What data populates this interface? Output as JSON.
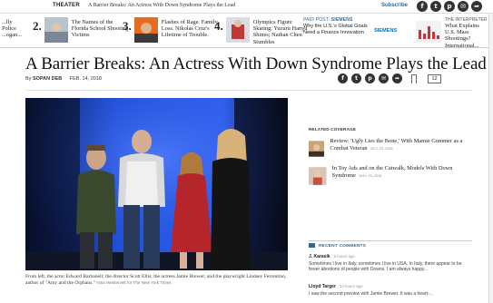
{
  "topbar": {
    "section": "THEATER",
    "headline": "A Barrier Breaks: An Actress With Down Syndrome Plays the Lead",
    "subscribe": "Subscribe"
  },
  "trending": [
    {
      "num": "",
      "text": "...lly\nPolice\n...ogan..."
    },
    {
      "num": "2.",
      "text": "The Names of the Florida School Shooting Victims"
    },
    {
      "num": "3.",
      "text": "Flashes of Rage. Family Loss. Nikolas Cruz's Lifetime of Trouble."
    },
    {
      "num": "4.",
      "text": "Olympics Figure Skating: Yuzuru Hanyu Shines; Nathan Chen Stumbles"
    }
  ],
  "ad": {
    "label_prefix": "PAID POST:",
    "label_brand": "SIEMENS",
    "text": "Why the U.S.'s Global Goals Need a Finance Innovation",
    "brand": "SIEMENS"
  },
  "ad2": {
    "label": "THE INTERPRETER",
    "text": "What Explains U.S. Mass Shootings? International..."
  },
  "article": {
    "title": "A Barrier Breaks: An Actress With Down Syndrome Plays the Lead",
    "byline_prefix": "By",
    "author": "SOPAN DEB",
    "date": "FEB. 14, 2018",
    "comment_count": "12"
  },
  "caption": {
    "text": "From left, the actor Edward Barbanell; the director Scott Ellis; the actress Jamie Brewer; and the playwright Lindsey Ferrentino, author of \"Amy and the Orphans.\"",
    "credit": "Nina Westervelt for The New York Times"
  },
  "related": {
    "heading": "RELATED COVERAGE",
    "items": [
      {
        "title": "Review: 'Ugly Lies the Bone,' With Mamie Gummer as a Combat Veteran",
        "date": "OCT. 23, 2016"
      },
      {
        "title": "In Toy Ads and on the Catwalk, Models With Down Syndrome",
        "date": "NOV. 23, 2016"
      }
    ]
  },
  "comments": {
    "heading": "RECENT COMMENTS",
    "items": [
      {
        "user": "J. Karasik",
        "ago": "6 hours ago",
        "body": "Sometimes I live in Italy, sometimes I live in USA. In Italy, there appear to be fewer abortions of people with Downs. I am always happy..."
      },
      {
        "user": "Lloyd Targer",
        "ago": "14 hours ago",
        "body": "I saw the second preview with Jamie Brewer. It was a heart-..."
      }
    ]
  },
  "colors": {
    "link": "#326891",
    "stage_blue": "#1f4fd8",
    "dress_red": "#b4262c"
  },
  "icons": [
    "facebook-icon",
    "twitter-icon",
    "pinterest-icon",
    "email-icon",
    "share-icon",
    "bookmark-icon",
    "comment-icon"
  ]
}
